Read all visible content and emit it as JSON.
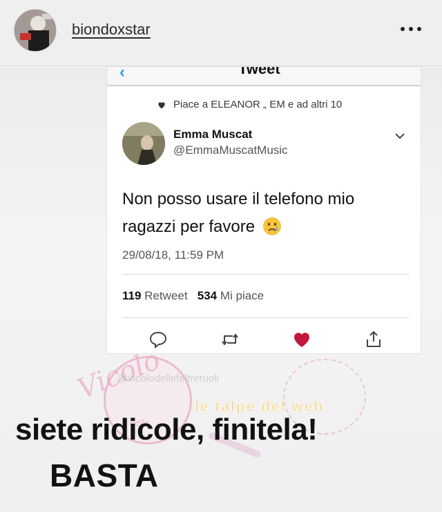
{
  "story": {
    "username": "biondoxstar"
  },
  "tweet_screen": {
    "topbar_title": "Tweet",
    "likes_line": "Piace a ELEANOR „ EM e ad altri 10",
    "author_name": "Emma Muscat",
    "author_handle": "@EmmaMuscatMusic",
    "text": "Non posso usare il telefono mio ragazzi per favore",
    "timestamp": "29/08/18, 11:59 PM",
    "retweet_count": "119",
    "retweet_label": "Retweet",
    "like_count": "534",
    "like_label": "Mi piace",
    "accent_color": "#1da1f2",
    "like_color": "#c2183a"
  },
  "watermarks": {
    "seal_script": "Vicolo",
    "seal_small": "delle",
    "handle": "@vicolodellefeltreruoli",
    "banner": "le talpe del web"
  },
  "caption": {
    "line1": "siete ridicole, finitela!",
    "line2": "BASTA"
  },
  "icons": {
    "more": "more-dots-icon",
    "liked": "heart-filled-icon",
    "reply": "reply-icon",
    "retweet": "retweet-icon",
    "like": "heart-icon",
    "share": "share-icon",
    "menu": "chevron-down-icon",
    "emoji": "crying-face-emoji"
  }
}
